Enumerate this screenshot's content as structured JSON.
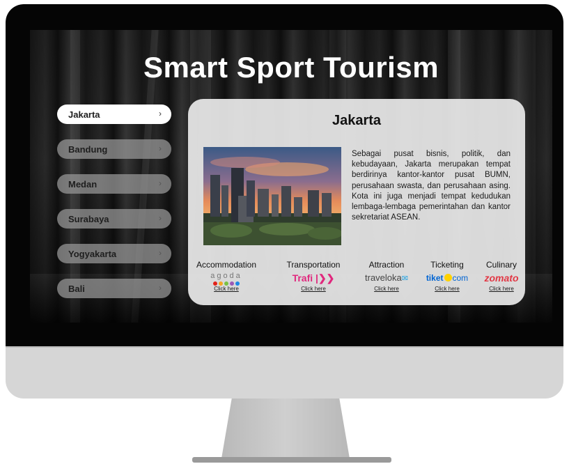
{
  "app": {
    "title": "Smart Sport Tourism"
  },
  "sidebar": {
    "items": [
      {
        "label": "Jakarta",
        "active": true
      },
      {
        "label": "Bandung",
        "active": false
      },
      {
        "label": "Medan",
        "active": false
      },
      {
        "label": "Surabaya",
        "active": false
      },
      {
        "label": "Yogyakarta",
        "active": false
      },
      {
        "label": "Bali",
        "active": false
      }
    ],
    "chevron": "›"
  },
  "card": {
    "title": "Jakarta",
    "description": "Sebagai pusat bisnis, politik, dan kebudayaan, Jakarta merupakan tempat berdirinya kantor-kantor pusat BUMN, perusahaan swasta, dan perusahaan asing. Kota ini juga menjadi tempat kedudukan lembaga-lembaga pemerintahan dan kantor sekretariat ASEAN.",
    "image": "jakarta-skyline-sunset"
  },
  "categories": [
    {
      "label": "Accommodation",
      "brand": "agoda",
      "link": "Click here"
    },
    {
      "label": "Transportation",
      "brand": "Trafi",
      "link": "Click here"
    },
    {
      "label": "Attraction",
      "brand": "traveloka",
      "link": "Click here"
    },
    {
      "label": "Ticketing",
      "brand_prefix": "tiket",
      "brand_suffix": "com",
      "link": "Click here"
    },
    {
      "label": "Culinary",
      "brand": "zomato",
      "link": "Click here"
    }
  ],
  "colors": {
    "agoda_dots": [
      "#e2231a",
      "#f5a623",
      "#7ac143",
      "#9b59b6",
      "#1e88e5"
    ],
    "trafi": "#e0287d",
    "tiket": "#0064d2",
    "zomato": "#e23744"
  }
}
